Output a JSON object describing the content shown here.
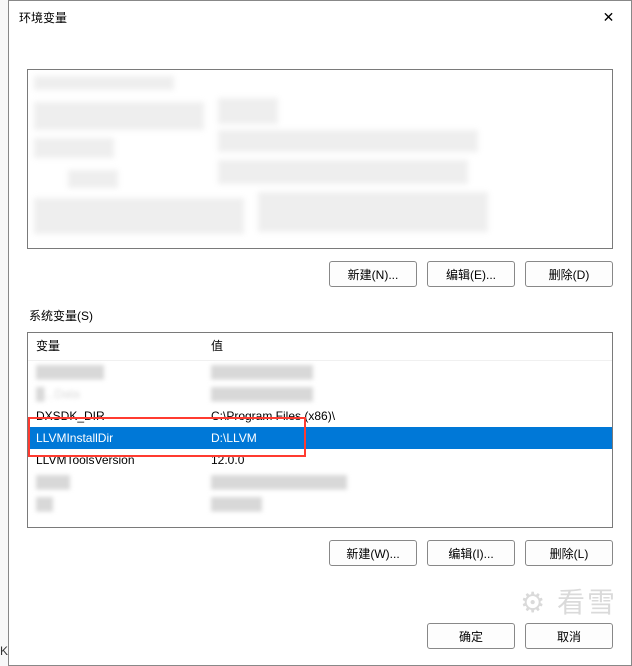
{
  "dialog": {
    "title": "环境变量"
  },
  "userSection": {
    "buttons": {
      "new": "新建(N)...",
      "edit": "编辑(E)...",
      "delete": "删除(D)"
    }
  },
  "systemSection": {
    "label": "系统变量(S)",
    "headers": {
      "variable": "变量",
      "value": "值"
    },
    "rows": [
      {
        "variable": "DXSDK_DIR",
        "value": "C:\\Program Files (x86)\\"
      },
      {
        "variable": "LLVMInstallDir",
        "value": "D:\\LLVM"
      },
      {
        "variable": "LLVMToolsVersion",
        "value": "12.0.0"
      }
    ],
    "buttons": {
      "new": "新建(W)...",
      "edit": "编辑(I)...",
      "delete": "删除(L)"
    }
  },
  "bottom": {
    "ok": "确定",
    "cancel": "取消"
  },
  "leftEdge": "K"
}
